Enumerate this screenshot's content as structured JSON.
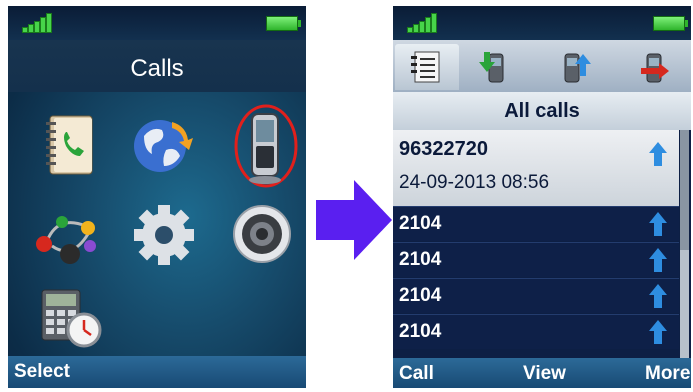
{
  "left_screen": {
    "title": "Calls",
    "softkey_left": "Select",
    "icons": [
      "contacts-book-icon",
      "globe-sync-icon",
      "phone-handset-icon",
      "network-nodes-icon",
      "settings-gear-icon",
      "speaker-icon",
      "calculator-clock-icon"
    ],
    "highlight_color": "#e0201c"
  },
  "right_screen": {
    "tabs": [
      "all-calls-tab-icon",
      "incoming-calls-tab-icon",
      "outgoing-calls-tab-icon",
      "missed-calls-tab-icon"
    ],
    "header": "All calls",
    "selected_call": {
      "number": "96322720",
      "datetime": "24-09-2013 08:56"
    },
    "calls": [
      {
        "number": "2104"
      },
      {
        "number": "2104"
      },
      {
        "number": "2104"
      },
      {
        "number": "2104"
      }
    ],
    "softkeys": {
      "left": "Call",
      "middle": "View",
      "right": "More"
    }
  },
  "colors": {
    "arrow": "#5a1ff0",
    "signal": "#47d44a",
    "softbar": "#245d8a",
    "list_bg": "#0e2048",
    "call_direction_arrow": "#2e8de0"
  }
}
